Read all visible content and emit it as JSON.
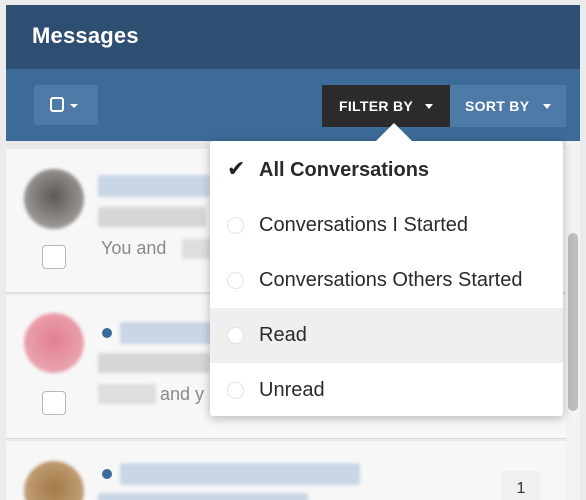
{
  "header": {
    "title": "Messages"
  },
  "toolbar": {
    "filter_label": "FILTER BY",
    "sort_label": "SORT BY"
  },
  "filter_menu": {
    "options": [
      {
        "label": "All Conversations",
        "selected": true
      },
      {
        "label": "Conversations I Started",
        "selected": false
      },
      {
        "label": "Conversations Others Started",
        "selected": false
      },
      {
        "label": "Read",
        "selected": false
      },
      {
        "label": "Unread",
        "selected": false
      }
    ]
  },
  "messages": [
    {
      "snippet": "You and",
      "unread": false,
      "avatar_color": "#7a7573"
    },
    {
      "snippet": "and y",
      "unread": true,
      "avatar_color": "#e59aa6"
    },
    {
      "snippet": "",
      "unread": true,
      "count": "1",
      "avatar_color": "#b08a5a"
    }
  ],
  "colors": {
    "titlebar": "#2e4e72",
    "toolbar": "#3d6b99",
    "filter_active": "#2b2b2b",
    "unread_dot": "#3d6b99"
  }
}
